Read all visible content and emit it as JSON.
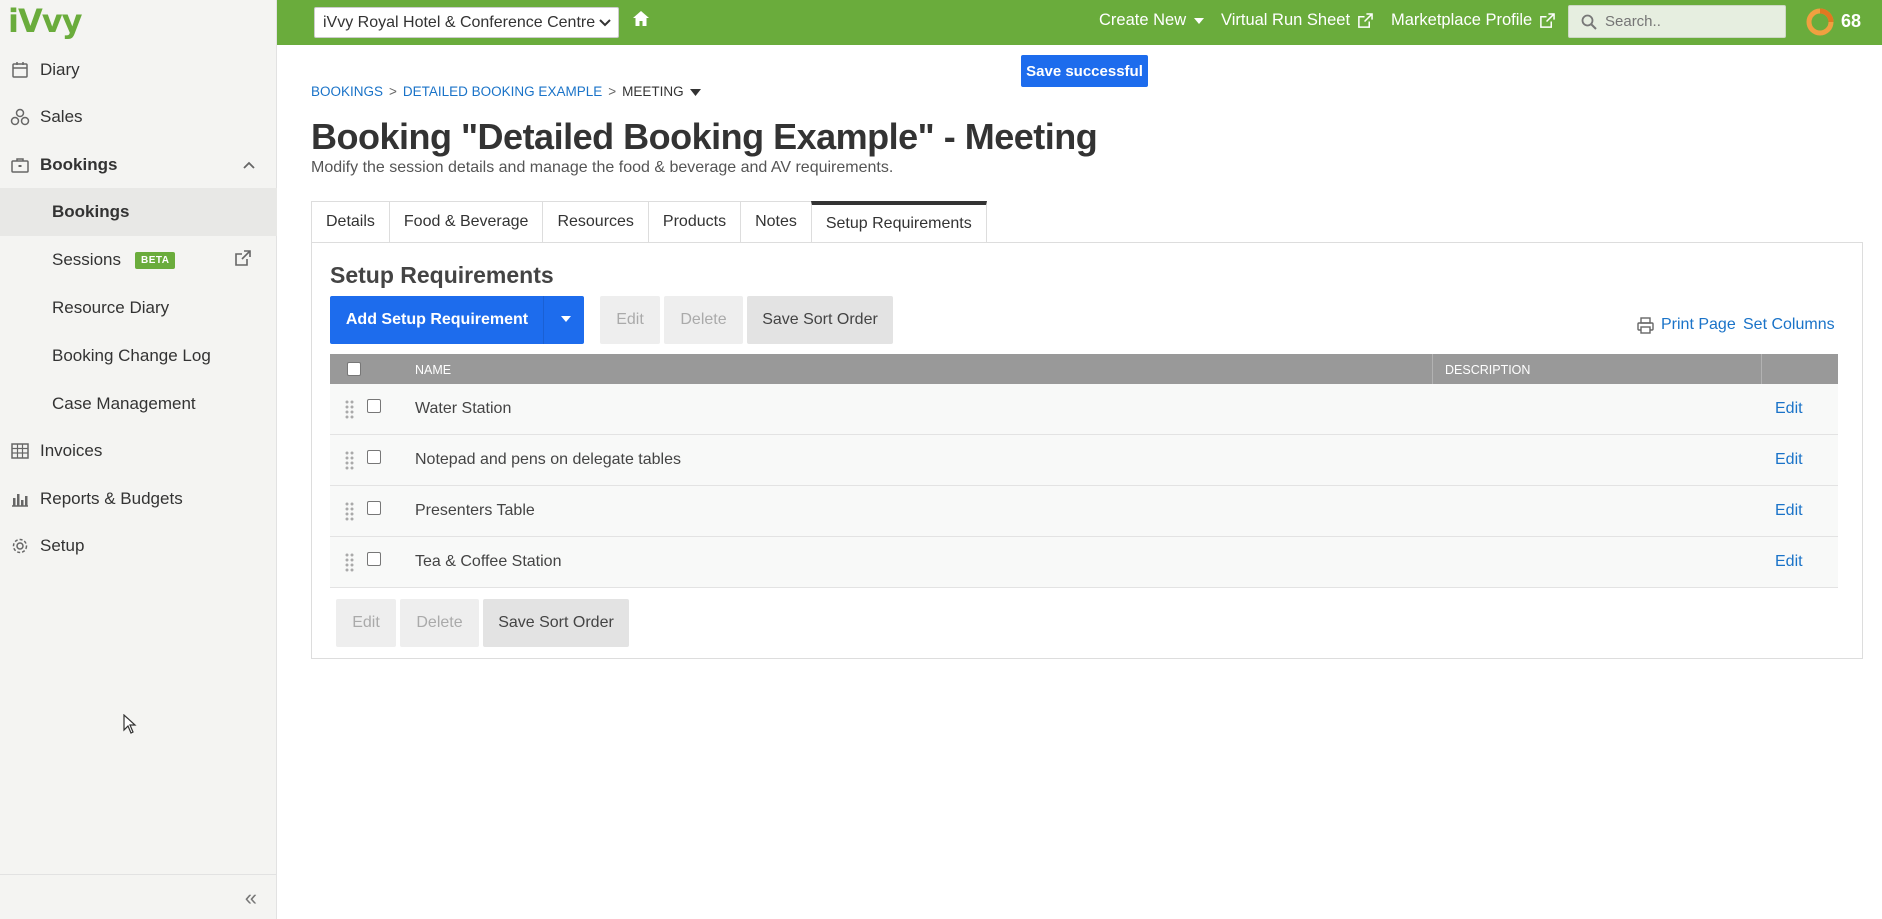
{
  "app": {
    "logo": "iVvy"
  },
  "sidebar": {
    "items": [
      {
        "label": "Diary",
        "icon": "calendar-icon"
      },
      {
        "label": "Sales",
        "icon": "sales-icon"
      },
      {
        "label": "Bookings",
        "icon": "briefcase-icon"
      },
      {
        "label": "Invoices",
        "icon": "invoice-icon"
      },
      {
        "label": "Reports & Budgets",
        "icon": "chart-icon"
      },
      {
        "label": "Setup",
        "icon": "gear-icon"
      }
    ],
    "sub_items": [
      {
        "label": "Bookings"
      },
      {
        "label": "Sessions",
        "badge": "BETA"
      },
      {
        "label": "Resource Diary"
      },
      {
        "label": "Booking Change Log"
      },
      {
        "label": "Case Management"
      }
    ]
  },
  "topbar": {
    "venue": "iVvy Royal Hotel & Conference Centre",
    "create_new": "Create New",
    "virtual_run_sheet": "Virtual Run Sheet",
    "marketplace_profile": "Marketplace Profile",
    "search_placeholder": "Search..",
    "count": "68",
    "brand_color": "#6aac3c"
  },
  "toast": {
    "text": "Save successful"
  },
  "breadcrumb": {
    "items": [
      "BOOKINGS",
      "DETAILED BOOKING EXAMPLE"
    ],
    "current": "MEETING",
    "separator": ">"
  },
  "page": {
    "title": "Booking \"Detailed Booking Example\" - Meeting",
    "subtitle": "Modify the session details and manage the food & beverage and AV requirements."
  },
  "tabs": [
    {
      "label": "Details"
    },
    {
      "label": "Food & Beverage"
    },
    {
      "label": "Resources"
    },
    {
      "label": "Products"
    },
    {
      "label": "Notes"
    },
    {
      "label": "Setup Requirements",
      "active": true
    }
  ],
  "panel": {
    "title": "Setup Requirements",
    "add_button": "Add Setup Requirement",
    "edit": "Edit",
    "delete": "Delete",
    "save_sort": "Save Sort Order",
    "print_page": "Print Page",
    "set_columns": "Set Columns"
  },
  "table": {
    "columns": [
      "NAME",
      "DESCRIPTION"
    ],
    "rows": [
      {
        "name": "Water Station",
        "description": "",
        "action": "Edit"
      },
      {
        "name": "Notepad and pens on delegate tables",
        "description": "",
        "action": "Edit"
      },
      {
        "name": "Presenters Table",
        "description": "",
        "action": "Edit"
      },
      {
        "name": "Tea & Coffee Station",
        "description": "",
        "action": "Edit"
      }
    ]
  }
}
